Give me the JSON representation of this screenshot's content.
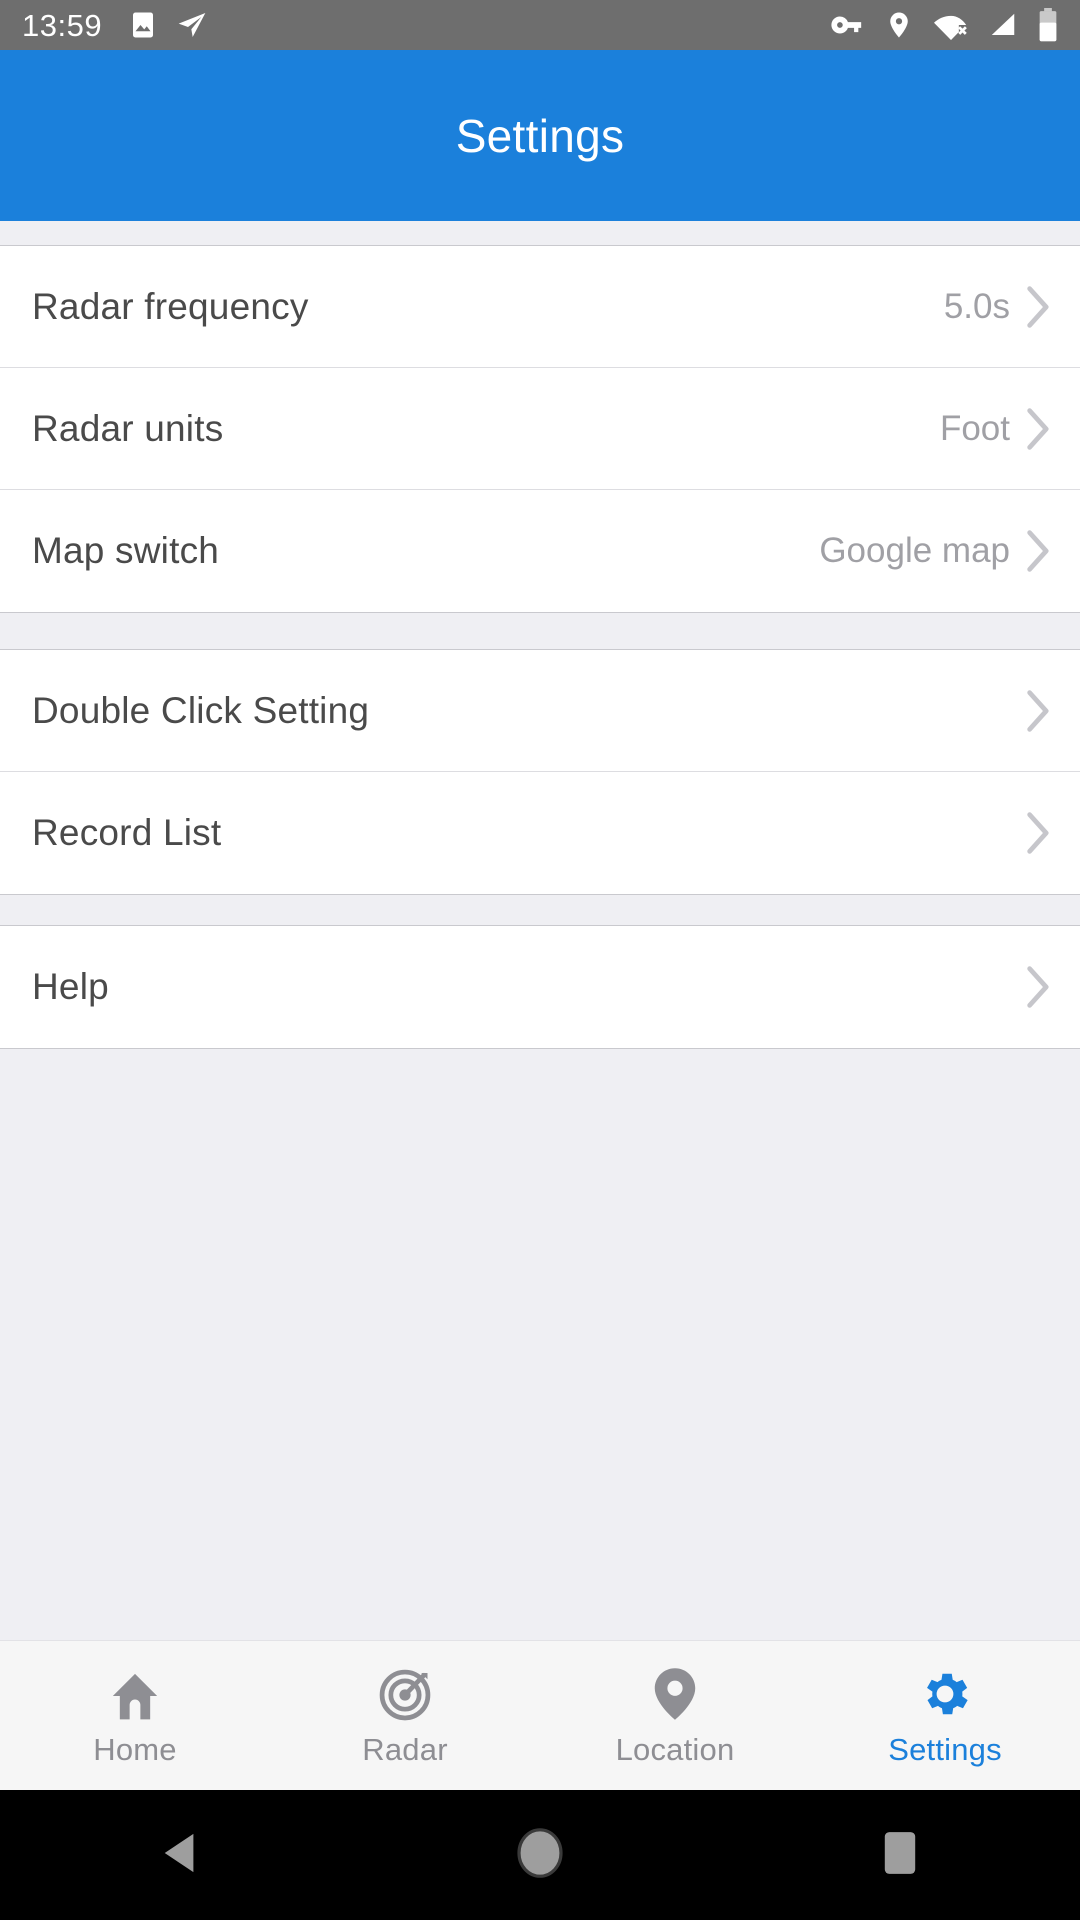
{
  "status_bar": {
    "time": "13:59",
    "background_color": "#6E6E6E",
    "left_icons": [
      {
        "name": "image-icon",
        "label": "Screenshot"
      },
      {
        "name": "send-icon",
        "label": "Telegram"
      }
    ],
    "right_icons": [
      {
        "name": "vpn-key-icon",
        "label": "VPN"
      },
      {
        "name": "location-pin-icon",
        "label": "Location"
      },
      {
        "name": "wifi-off-icon",
        "label": "Wi-Fi disconnected"
      },
      {
        "name": "cellular-signal-icon",
        "label": "Cellular"
      },
      {
        "name": "battery-icon",
        "label": "Battery"
      }
    ]
  },
  "app_bar": {
    "title": "Settings",
    "background_color": "#1B80DB",
    "title_color": "#FFFFFF"
  },
  "settings": {
    "groups": [
      {
        "rows": [
          {
            "label": "Radar frequency",
            "value": "5.0s",
            "chevron": true
          },
          {
            "label": "Radar units",
            "value": "Foot",
            "chevron": true
          },
          {
            "label": "Map switch",
            "value": "Google map",
            "chevron": true
          }
        ]
      },
      {
        "rows": [
          {
            "label": "Double Click Setting",
            "value": "",
            "chevron": true
          },
          {
            "label": "Record List",
            "value": "",
            "chevron": true
          }
        ]
      },
      {
        "rows": [
          {
            "label": "Help",
            "value": "",
            "chevron": true
          }
        ]
      }
    ],
    "row_background": "#FFFFFF",
    "page_background": "#EFEFF3",
    "label_color": "#4A4A4A",
    "value_color": "#A0A0A5"
  },
  "bottom_nav": {
    "background_color": "#F6F6F6",
    "active_color": "#1B80DB",
    "inactive_color": "#8E8E93",
    "items": [
      {
        "label": "Home",
        "icon": "home-icon",
        "active": false
      },
      {
        "label": "Radar",
        "icon": "radar-target-icon",
        "active": false
      },
      {
        "label": "Location",
        "icon": "location-pin-icon",
        "active": false
      },
      {
        "label": "Settings",
        "icon": "gear-icon",
        "active": true
      }
    ]
  },
  "android_nav": {
    "background_color": "#000000",
    "buttons": [
      {
        "name": "back-button",
        "icon": "triangle-left-icon"
      },
      {
        "name": "home-button",
        "icon": "circle-icon"
      },
      {
        "name": "recents-button",
        "icon": "square-icon"
      }
    ]
  }
}
